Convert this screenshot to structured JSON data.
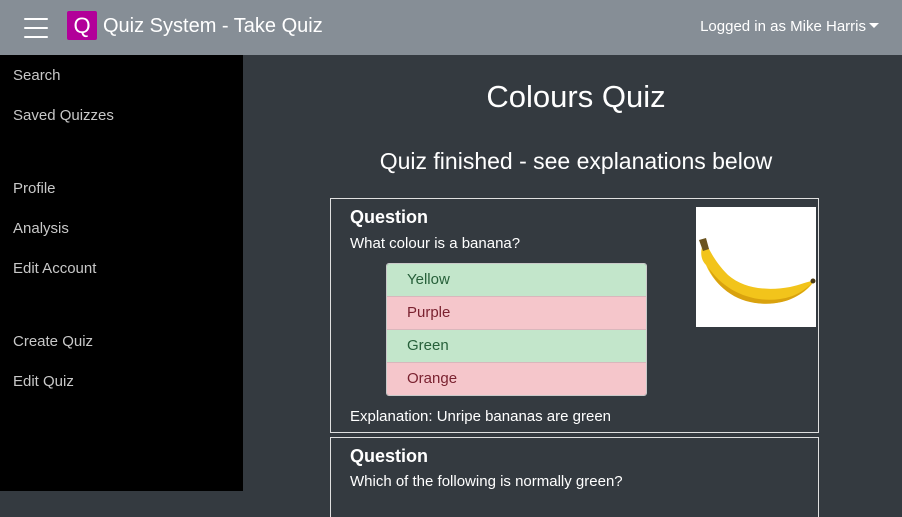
{
  "header": {
    "logo_letter": "Q",
    "brand_color": "#b20099",
    "title": "Quiz System - Take Quiz",
    "user_label": "Logged in as Mike Harris"
  },
  "sidebar": {
    "items": [
      {
        "label": "Search"
      },
      {
        "label": "Saved Quizzes"
      },
      {
        "label": "Profile"
      },
      {
        "label": "Analysis"
      },
      {
        "label": "Edit Account"
      },
      {
        "label": "Create Quiz"
      },
      {
        "label": "Edit Quiz"
      }
    ]
  },
  "main": {
    "quiz_title": "Colours Quiz",
    "status": "Quiz finished - see explanations below",
    "questions": [
      {
        "heading": "Question",
        "text": "What colour is a banana?",
        "image_icon": "banana-image",
        "options": [
          {
            "label": "Yellow",
            "state": "correct"
          },
          {
            "label": "Purple",
            "state": "wrong"
          },
          {
            "label": "Green",
            "state": "correct"
          },
          {
            "label": "Orange",
            "state": "wrong"
          }
        ],
        "explanation": "Explanation: Unripe bananas are green"
      },
      {
        "heading": "Question",
        "text": "Which of the following is normally green?"
      }
    ]
  },
  "colors": {
    "navbar": "#868e96",
    "sidebar": "#000000",
    "content_bg": "#343a40",
    "correct_bg": "#c3e6cb",
    "wrong_bg": "#f5c6cb"
  }
}
